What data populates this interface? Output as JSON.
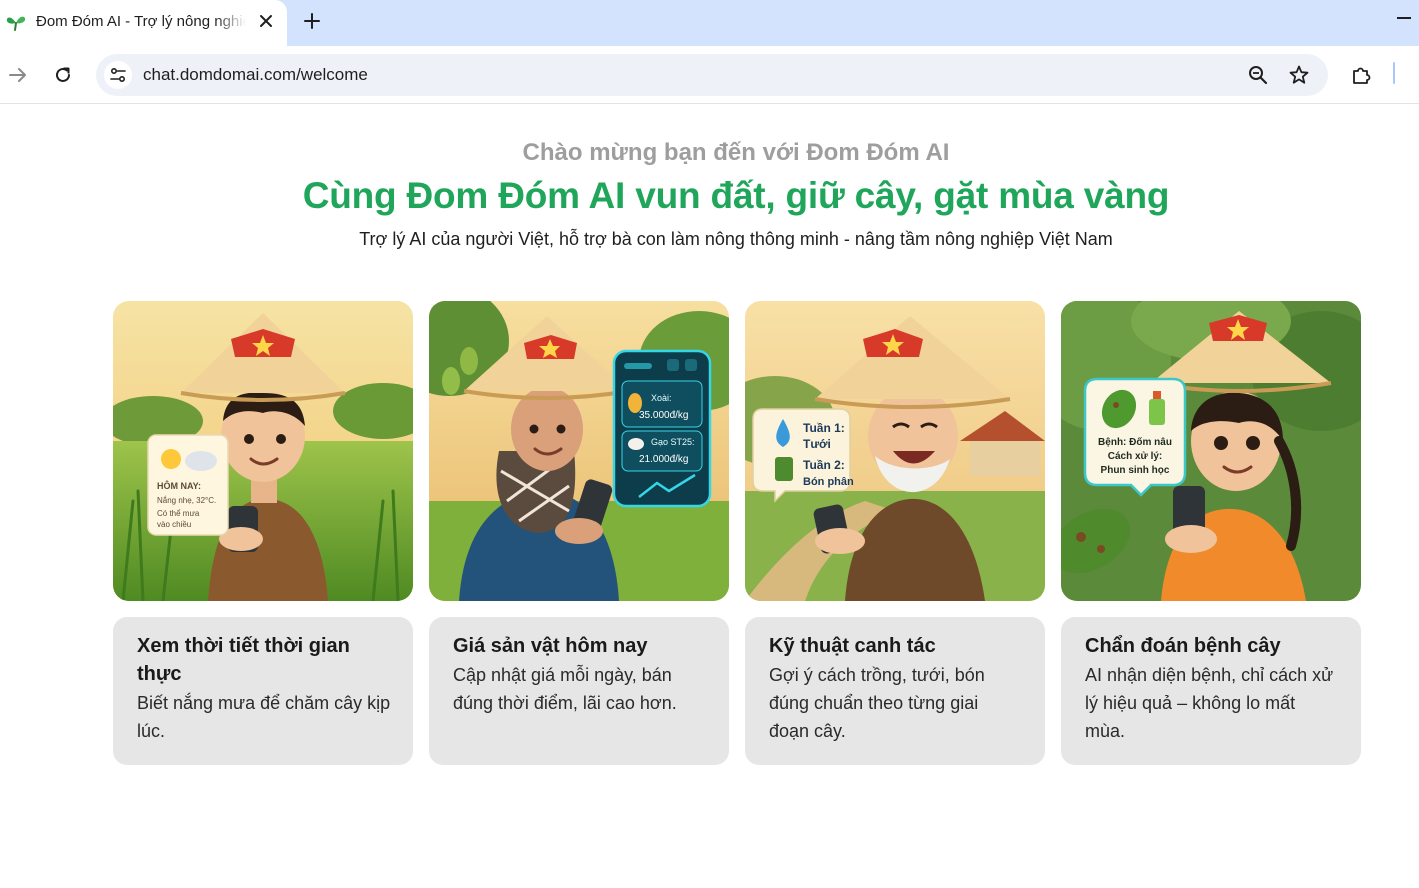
{
  "browser": {
    "tab_title": "Đom Đóm AI - Trợ lý nông nghiệp",
    "url": "chat.domdomai.com/welcome"
  },
  "hero": {
    "welcome": "Chào mừng bạn đến với Đom Đóm AI",
    "headline": "Cùng Đom Đóm AI vun đất, giữ cây, gặt mùa vàng",
    "tagline": "Trợ lý AI của người Việt, hỗ trợ bà con làm nông thông minh - nâng tầm nông nghiệp Việt Nam"
  },
  "colors": {
    "brand_green": "#1fa65a",
    "card_bg": "#e6e6e6",
    "tab_strip": "#d3e3fd"
  },
  "cards": [
    {
      "title": "Xem thời tiết thời gian thực",
      "description": "Biết nắng mưa để chăm cây kịp lúc.",
      "bubble": {
        "heading": "HÔM NAY:",
        "line1": "Nắng nhẹ, 32°C.",
        "line2": "Có thể mưa",
        "line3": "vào chiều"
      }
    },
    {
      "title": "Giá sản vật hôm nay",
      "description": "Cập nhật giá mỗi ngày, bán đúng thời điểm, lãi cao hơn.",
      "bubble": {
        "item1_name": "Xoài:",
        "item1_price": "35.000đ/kg",
        "item2_name": "Gạo ST25:",
        "item2_price": "21.000đ/kg"
      }
    },
    {
      "title": "Kỹ thuật canh tác",
      "description": "Gợi ý cách trồng, tưới, bón đúng chuẩn theo từng giai đoạn cây.",
      "bubble": {
        "line1": "Tuần 1:",
        "line2": "Tưới",
        "line3": "Tuần 2:",
        "line4": "Bón phân"
      }
    },
    {
      "title": "Chẩn đoán bệnh cây",
      "description": "AI nhận diện bệnh, chỉ cách xử lý hiệu quả – không lo mất mùa.",
      "bubble": {
        "line1": "Bệnh: Đốm nâu",
        "line2": "Cách xử lý:",
        "line3": "Phun sinh học"
      }
    }
  ]
}
